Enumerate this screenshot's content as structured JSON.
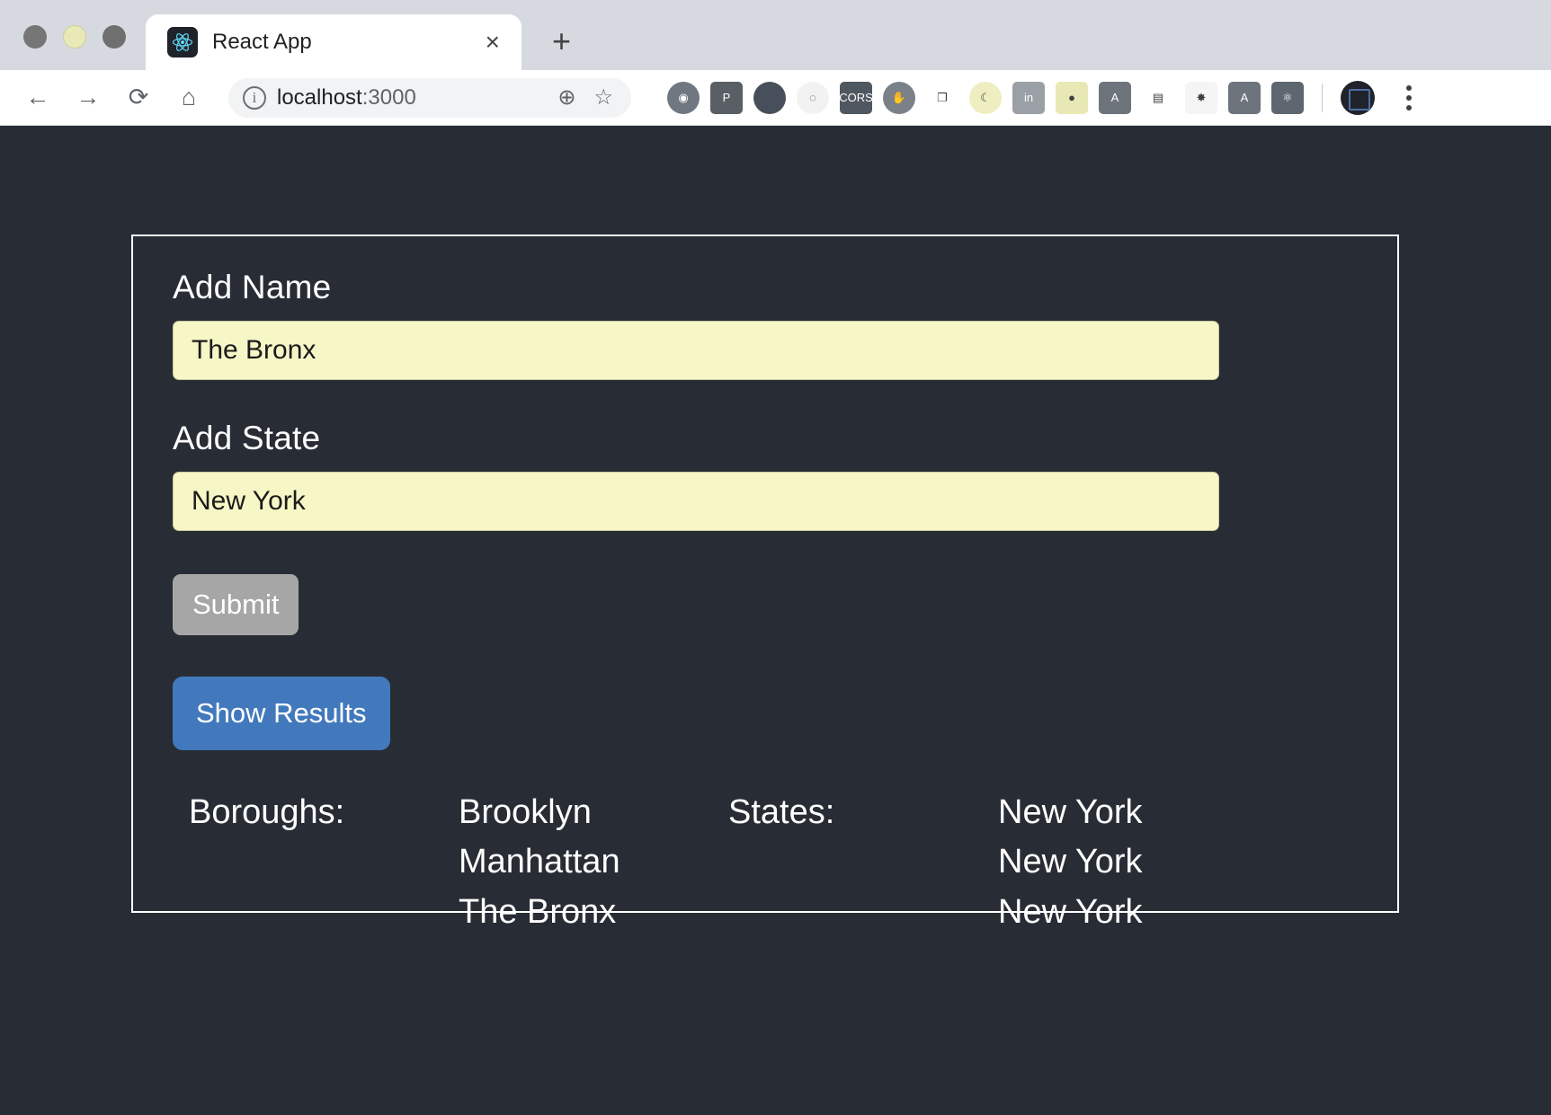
{
  "browser": {
    "window_controls": [
      "close-dot",
      "minimize-dot",
      "maximize-dot"
    ],
    "tab": {
      "title": "React App",
      "favicon": "react-logo-icon",
      "close_label": "×"
    },
    "new_tab_label": "+",
    "nav": {
      "back": "←",
      "forward": "→",
      "reload": "⟳",
      "home": "⌂"
    },
    "omnibox": {
      "info_glyph": "i",
      "host": "localhost",
      "port": ":3000",
      "zoom_glyph": "⊕",
      "bookmark_glyph": "☆"
    },
    "extensions": [
      {
        "name": "target-globe-extension",
        "glyph": "◉",
        "bg": "#6f7780",
        "shape": "circ"
      },
      {
        "name": "pocket-extension",
        "glyph": "P",
        "bg": "#5a5f66",
        "shape": "sq"
      },
      {
        "name": "speech-bubble-extension",
        "glyph": "",
        "bg": "#47505a",
        "shape": "circ"
      },
      {
        "name": "atom-orbit-extension",
        "glyph": "◌",
        "bg": "#f2f2f2",
        "shape": "circ"
      },
      {
        "name": "cors-extension",
        "glyph": "CORS",
        "bg": "#4f5760",
        "shape": "sq"
      },
      {
        "name": "hand-wave-extension",
        "glyph": "✋",
        "bg": "#7a8189",
        "shape": "circ"
      },
      {
        "name": "cast-extension",
        "glyph": "❐",
        "bg": "#ffffff",
        "shape": "sq"
      },
      {
        "name": "dark-reader-extension",
        "glyph": "☾",
        "bg": "#eeeec0",
        "shape": "circ"
      },
      {
        "name": "linkedin-extension",
        "glyph": "in",
        "bg": "#9aa0a6",
        "shape": "sq"
      },
      {
        "name": "android-extension",
        "glyph": "●",
        "bg": "#e8e8b4",
        "shape": "sq"
      },
      {
        "name": "angular-shield-extension",
        "glyph": "A",
        "bg": "#6d747c",
        "shape": "sq"
      },
      {
        "name": "form-filler-extension",
        "glyph": "▤",
        "bg": "#ffffff",
        "shape": "sq"
      },
      {
        "name": "redux-devtools-extension",
        "glyph": "✸",
        "bg": "#f5f5f5",
        "shape": "sq"
      },
      {
        "name": "angular-devtools-extension",
        "glyph": "A",
        "bg": "#6d747c",
        "shape": "sq"
      },
      {
        "name": "react-devtools-extension",
        "glyph": "⚛",
        "bg": "#5e6670",
        "shape": "sq"
      }
    ],
    "profile_avatar": "user-avatar",
    "menu_label": "browser-menu"
  },
  "app": {
    "name_label": "Add Name",
    "name_value": "The Bronx",
    "name_placeholder": "",
    "state_label": "Add State",
    "state_value": "New York",
    "state_placeholder": "",
    "submit_label": "Submit",
    "show_results_label": "Show Results",
    "results": {
      "boroughs_heading": "Boroughs:",
      "boroughs": [
        "Brooklyn",
        "Manhattan",
        "The Bronx"
      ],
      "states_heading": "States:",
      "states": [
        "New York",
        "New York",
        "New York"
      ]
    }
  },
  "colors": {
    "page_bg": "#282c34",
    "input_bg": "#f6f6c6",
    "primary_button": "#4279bd",
    "secondary_button": "#a6a6a6",
    "text": "#ffffff"
  }
}
